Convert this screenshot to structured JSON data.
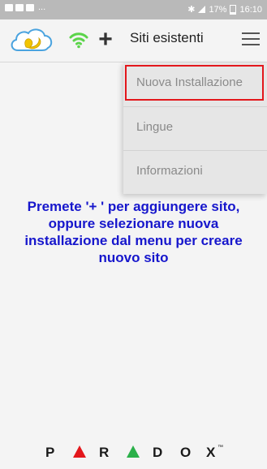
{
  "status_bar": {
    "dots": "...",
    "battery": "17%",
    "time": "16:10"
  },
  "toolbar": {
    "title": "Siti esistenti",
    "add_icon": "plus-icon",
    "wifi_icon": "wifi-icon",
    "menu_icon": "hamburger-menu-icon",
    "logo_icon": "swan-cloud-logo"
  },
  "menu": {
    "items": [
      {
        "label": "Nuova Installazione"
      },
      {
        "label": "Lingue"
      },
      {
        "label": "Informazioni"
      }
    ]
  },
  "main": {
    "message": "Premete '+ ' per aggiungere sito, oppure selezionare nuova installazione dal menu per creare nuovo sito"
  },
  "footer": {
    "brand": "PARADOX",
    "brand_mark": "™"
  },
  "colors": {
    "message": "#1616cc",
    "highlight": "#e3171c",
    "wifi": "#5bd44a",
    "logo_accent": "#f2c400",
    "logo_cloud": "#4aa3df"
  }
}
